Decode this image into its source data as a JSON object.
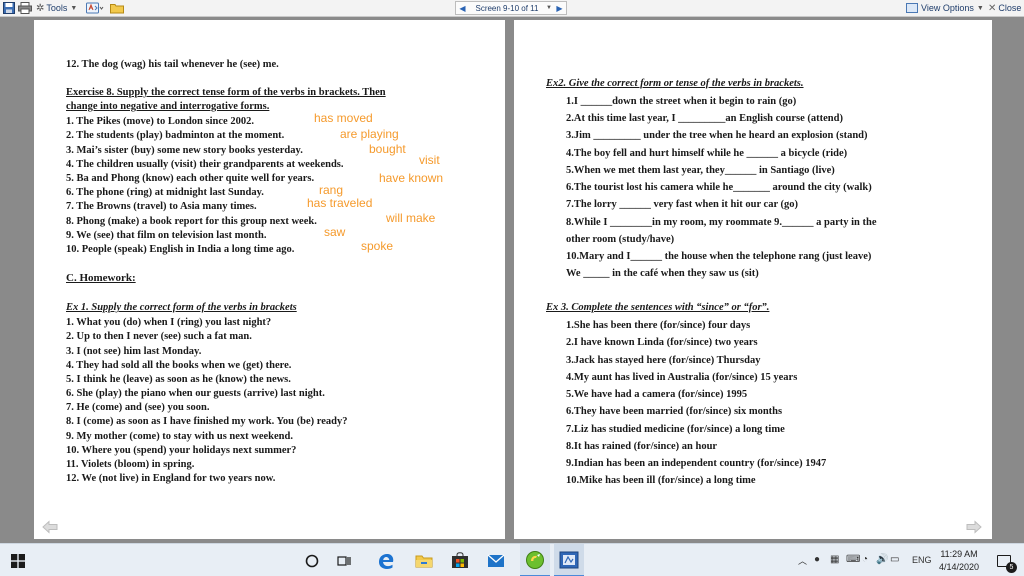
{
  "toolbar": {
    "tools_label": "Tools",
    "screen_label": "Screen 9-10 of 11",
    "view_options_label": "View Options",
    "close_label": "Close"
  },
  "left_page": {
    "line_12": "12. The dog (wag) his tail whenever he (see) me.",
    "ex8_title_1": "Exercise 8. Supply the correct tense form of the verbs in brackets. Then",
    "ex8_title_2": "change into negative and interrogative forms.",
    "ex8_items": [
      "1. The Pikes (move) to London since 2002.",
      "2. The students (play) badminton at the moment.",
      "3. Mai’s sister (buy) some new story books yesterday.",
      "4. The children usually (visit) their grandparents at weekends.",
      "5. Ba and Phong (know) each other quite well for years.",
      "6. The phone (ring) at midnight last Sunday.",
      "7. The Browns (travel) to Asia many times.",
      "8. Phong (make) a book report for this group next week.",
      "9. We (see) that film on television last month.",
      "10. People (speak) English in India a long time ago."
    ],
    "answers": [
      "has moved",
      "are playing",
      "bought",
      "visit",
      "have known",
      "rang",
      "has traveled",
      "will make",
      "saw",
      "spoke"
    ],
    "homework_heading": "C. Homework:",
    "ex1_title": "Ex 1. Supply the correct form of the verbs in brackets",
    "ex1_items": [
      "1. What you (do) when I (ring) you last night?",
      "2. Up to then I never (see) such a fat man.",
      "3. I (not see) him last Monday.",
      "4. They had sold all the books when we (get) there.",
      "5. I think he (leave) as soon as he (know) the news.",
      "6. She (play) the piano when our guests (arrive) last night.",
      "7. He (come) and (see) you soon.",
      "8. I (come) as soon as I have finished my work. You (be) ready?",
      "9. My mother (come) to stay with us next weekend.",
      "10. Where you (spend) your holidays next summer?",
      "11. Violets (bloom) in spring.",
      "12. We (not live) in England for two years now."
    ]
  },
  "right_page": {
    "ex2_title": "Ex2. Give the correct form or tense of the verbs in brackets.",
    "ex2_items": [
      "1.I ______down the street when it begin to rain (go)",
      "2.At this time last year, I _________an English course (attend)",
      "3.Jim _________ under the tree when he heard an explosion (stand)",
      "4.The boy fell and hurt himself while he ______ a bicycle (ride)",
      "5.When we met them last year, they______ in Santiago (live)",
      "6.The tourist lost his camera while he_______ around the city (walk)",
      "7.The lorry ______ very fast when it hit our car (go)",
      "8.While I ________in my room, my roommate 9.______ a party in the",
      "other room (study/have)",
      "10.Mary and I______ the house when the telephone rang (just leave)",
      "We _____ in the café when they saw us (sit)"
    ],
    "ex3_title": "Ex 3. Complete the sentences with “since” or “for”.",
    "ex3_items": [
      "1.She has been there  (for/since) four days",
      "2.I have known Linda (for/since) two years",
      "3.Jack has stayed here (for/since) Thursday",
      "4.My aunt has lived in Australia (for/since) 15 years",
      "5.We have had a camera (for/since) 1995",
      "6.They have been married (for/since) six months",
      "7.Liz has studied medicine (for/since) a long time",
      "8.It has rained (for/since) an hour",
      "9.Indian has been an independent country (for/since) 1947",
      "10.Mike has been ill (for/since) a long time"
    ]
  },
  "taskbar": {
    "time": "11:29 AM",
    "date": "4/14/2020",
    "language": "ENG",
    "notification_count": "5"
  }
}
